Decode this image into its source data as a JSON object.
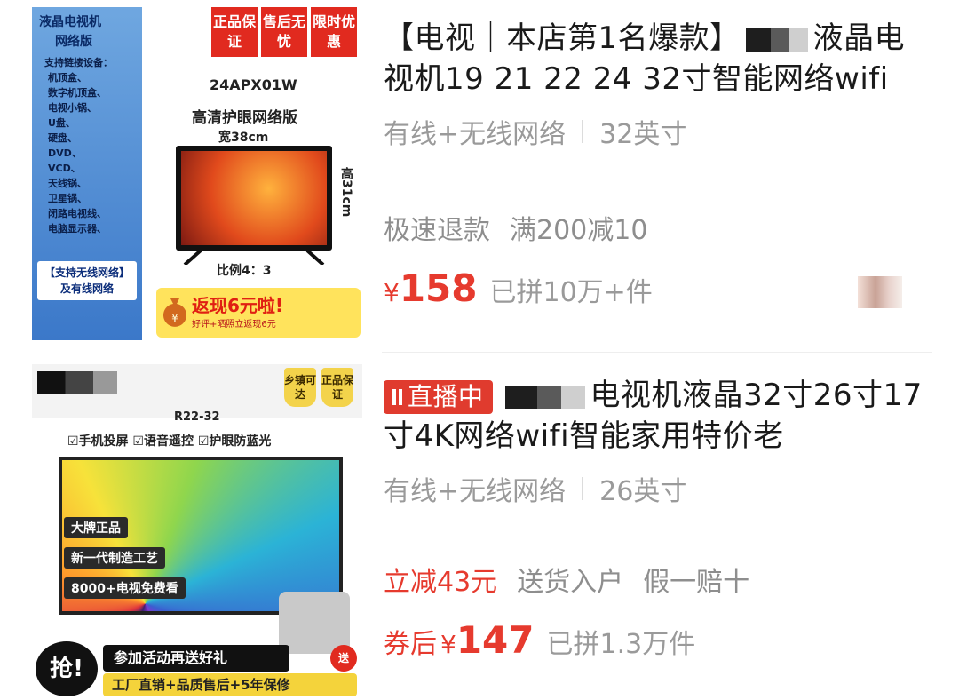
{
  "products": [
    {
      "title_prefix": "【电视｜本店第1名爆款】",
      "title_suffix": "液晶电视机19 21 22 24 32寸智能网络wifi",
      "spec_network": "有线+无线网络",
      "spec_size": "32英寸",
      "tags": [
        "极速退款",
        "满200减10"
      ],
      "price_symbol": "¥",
      "price": "158",
      "sold": "已拼10万+件",
      "thumb": {
        "brand": "液晶电视机",
        "brand2": "网络版",
        "support_title": "支持链接设备：",
        "devices": [
          "机顶盒、",
          "数字机顶盒、",
          "电视小锅、",
          "U盘、",
          "硬盘、",
          "DVD、",
          "VCD、",
          "天线锅、",
          "卫星锅、",
          "闭路电视线、",
          "电脑显示器、"
        ],
        "wireless": "【支持无线网络】",
        "wired": "及有线网络",
        "badges": [
          "正品保证",
          "售后无忧",
          "限时优惠"
        ],
        "model": "24APX01W",
        "subtitle": "高清护眼网络版",
        "width": "宽38cm",
        "height": "高31cm",
        "ratio": "比例4：3",
        "promo_big": "返现6元啦!",
        "promo_small": "好评+晒照立返现6元"
      }
    },
    {
      "live_label": "直播中",
      "title": "电视机液晶32寸26寸17寸4K网络wifi智能家用特价老",
      "spec_network": "有线+无线网络",
      "spec_size": "26英寸",
      "tags": [
        {
          "text": "立减43元",
          "red": true
        },
        {
          "text": "送货入户",
          "red": false
        },
        {
          "text": "假一赔十",
          "red": false
        }
      ],
      "price_prefix": "券后",
      "price_symbol": "¥",
      "price": "147",
      "sold": "已拼1.3万件",
      "thumb": {
        "badges": [
          "乡镇可达",
          "正品保证"
        ],
        "model": "R22-32",
        "features": "☑手机投屏 ☑语音遥控 ☑护眼防蓝光",
        "pills": [
          "大牌正品",
          "新一代制造工艺",
          "8000+电视免费看"
        ],
        "qiang": "抢!",
        "activity": "参加活动再送好礼",
        "footer": "工厂直销+品质售后+5年保修",
        "gift": "送"
      }
    }
  ]
}
